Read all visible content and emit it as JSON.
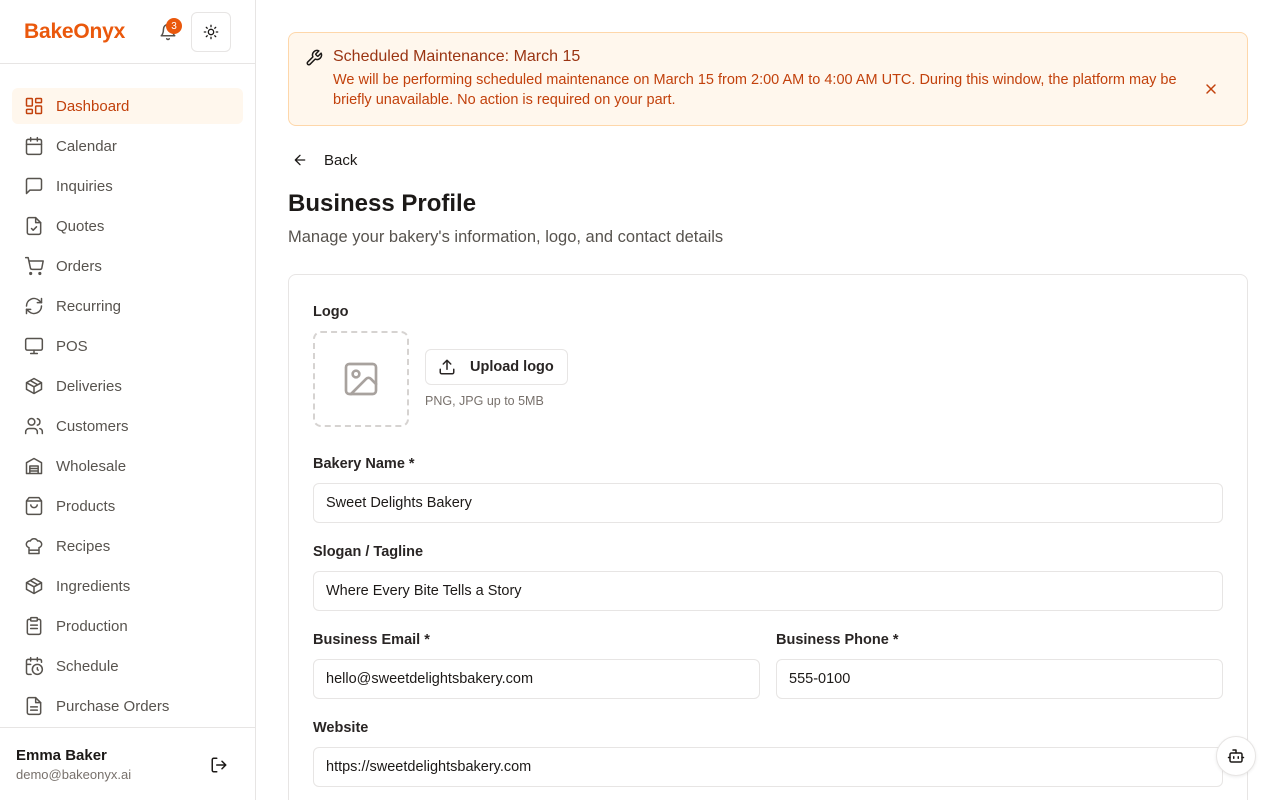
{
  "app": {
    "brand": "BakeOnyx",
    "notification_count": "3"
  },
  "sidebar": {
    "items": [
      {
        "label": "Dashboard",
        "icon": "dashboard-icon",
        "active": true
      },
      {
        "label": "Calendar",
        "icon": "calendar-icon"
      },
      {
        "label": "Inquiries",
        "icon": "chat-icon"
      },
      {
        "label": "Quotes",
        "icon": "file-check-icon"
      },
      {
        "label": "Orders",
        "icon": "cart-icon"
      },
      {
        "label": "Recurring",
        "icon": "refresh-icon"
      },
      {
        "label": "POS",
        "icon": "monitor-icon"
      },
      {
        "label": "Deliveries",
        "icon": "package-icon"
      },
      {
        "label": "Customers",
        "icon": "users-icon"
      },
      {
        "label": "Wholesale",
        "icon": "warehouse-icon"
      },
      {
        "label": "Products",
        "icon": "shopping-bag-icon"
      },
      {
        "label": "Recipes",
        "icon": "chef-hat-icon"
      },
      {
        "label": "Ingredients",
        "icon": "package-icon"
      },
      {
        "label": "Production",
        "icon": "clipboard-icon"
      },
      {
        "label": "Schedule",
        "icon": "calendar-clock-icon"
      },
      {
        "label": "Purchase Orders",
        "icon": "file-text-icon"
      }
    ]
  },
  "user": {
    "name": "Emma Baker",
    "email": "demo@bakeonyx.ai"
  },
  "banner": {
    "title": "Scheduled Maintenance: March 15",
    "text": "We will be performing scheduled maintenance on March 15 from 2:00 AM to 4:00 AM UTC. During this window, the platform may be briefly unavailable. No action is required on your part."
  },
  "page": {
    "back_label": "Back",
    "title": "Business Profile",
    "subtitle": "Manage your bakery's information, logo, and contact details"
  },
  "form": {
    "logo_label": "Logo",
    "upload_label": "Upload logo",
    "upload_hint": "PNG, JPG up to 5MB",
    "bakery_name_label": "Bakery Name *",
    "bakery_name_value": "Sweet Delights Bakery",
    "slogan_label": "Slogan / Tagline",
    "slogan_value": "Where Every Bite Tells a Story",
    "email_label": "Business Email *",
    "email_value": "hello@sweetdelightsbakery.com",
    "phone_label": "Business Phone *",
    "phone_value": "555-0100",
    "website_label": "Website",
    "website_value": "https://sweetdelightsbakery.com"
  },
  "colors": {
    "accent": "#ea580c",
    "active_bg": "#fff7ed",
    "banner_border": "#fed7aa"
  }
}
